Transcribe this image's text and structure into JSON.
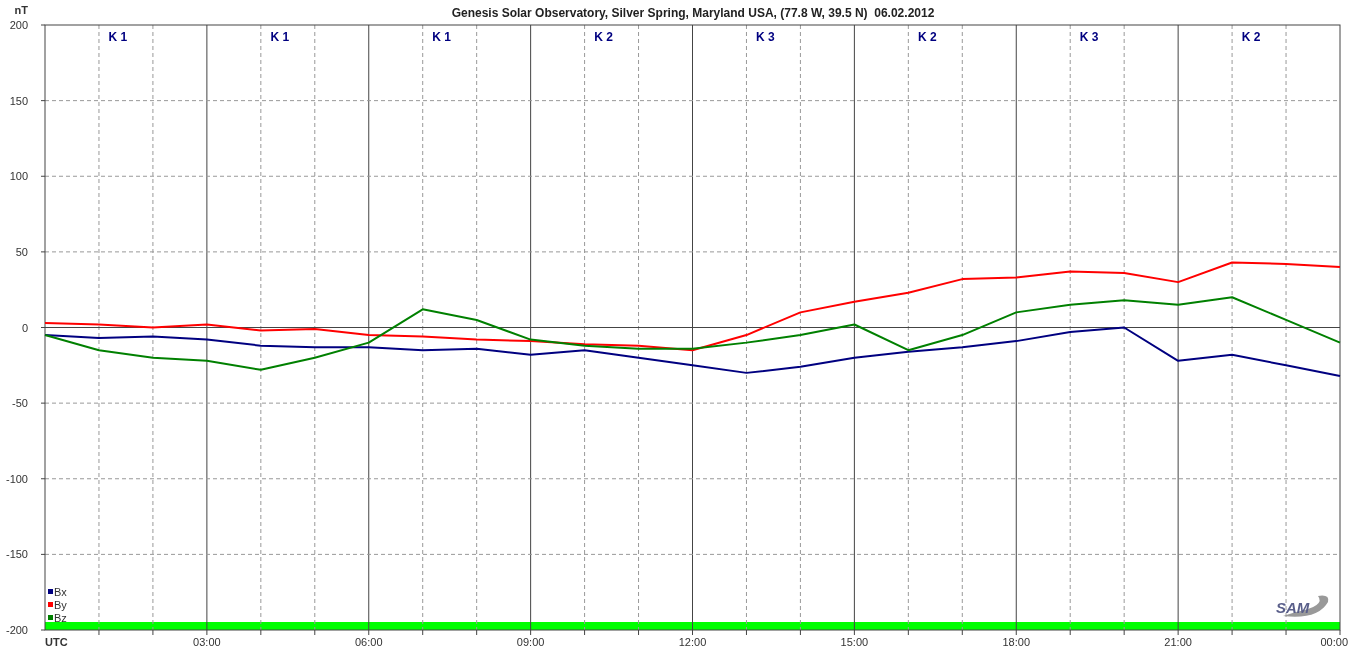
{
  "chart_data": {
    "type": "line",
    "title": "Genesis Solar Observatory, Silver Spring, Maryland USA, (77.8 W, 39.5 N)  06.02.2012",
    "xlabel": "UTC",
    "ylabel": "nT",
    "x": [
      0,
      1,
      2,
      3,
      4,
      5,
      6,
      7,
      8,
      9,
      10,
      11,
      12,
      13,
      14,
      15,
      16,
      17,
      18,
      19,
      20,
      21,
      22,
      23,
      24
    ],
    "grid": true,
    "legend": "lower left",
    "xlim": [
      0,
      24
    ],
    "ylim": [
      -200,
      200
    ],
    "xticks": [
      {
        "value": 3,
        "label": "03:00"
      },
      {
        "value": 6,
        "label": "06:00"
      },
      {
        "value": 9,
        "label": "09:00"
      },
      {
        "value": 12,
        "label": "12:00"
      },
      {
        "value": 15,
        "label": "15:00"
      },
      {
        "value": 18,
        "label": "18:00"
      },
      {
        "value": 21,
        "label": "21:00"
      },
      {
        "value": 24,
        "label": "00:00"
      }
    ],
    "yticks": [
      -200,
      -150,
      -100,
      -50,
      0,
      50,
      100,
      150,
      200
    ],
    "series": [
      {
        "name": "Bx",
        "color": "#000080",
        "values": [
          -5,
          -7,
          -6,
          -8,
          -12,
          -13,
          -13,
          -15,
          -14,
          -18,
          -15,
          -20,
          -25,
          -30,
          -26,
          -20,
          -16,
          -13,
          -9,
          -3,
          0,
          -22,
          -18,
          -25,
          -32
        ]
      },
      {
        "name": "By",
        "color": "#ff0000",
        "values": [
          3,
          2,
          0,
          2,
          -2,
          -1,
          -5,
          -6,
          -8,
          -9,
          -11,
          -12,
          -15,
          -5,
          10,
          17,
          23,
          32,
          33,
          37,
          36,
          30,
          43,
          42,
          40
        ]
      },
      {
        "name": "Bz",
        "color": "#008000",
        "values": [
          -5,
          -15,
          -20,
          -22,
          -28,
          -20,
          -10,
          12,
          5,
          -8,
          -12,
          -14,
          -14,
          -10,
          -5,
          2,
          -15,
          -5,
          10,
          15,
          18,
          15,
          20,
          5,
          -10
        ]
      }
    ]
  },
  "k_index": [
    {
      "label": "K 1"
    },
    {
      "label": "K 1"
    },
    {
      "label": "K 1"
    },
    {
      "label": "K 2"
    },
    {
      "label": "K 3"
    },
    {
      "label": "K 2"
    },
    {
      "label": "K 3"
    },
    {
      "label": "K 2"
    }
  ],
  "logo_text": "SAM"
}
